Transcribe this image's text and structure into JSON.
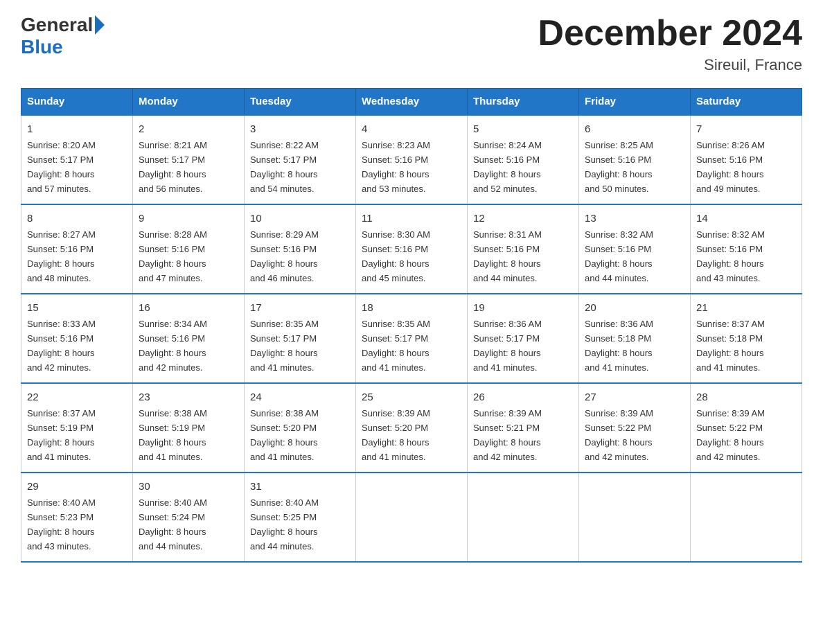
{
  "logo": {
    "general": "General",
    "blue": "Blue"
  },
  "title": "December 2024",
  "subtitle": "Sireuil, France",
  "weekdays": [
    "Sunday",
    "Monday",
    "Tuesday",
    "Wednesday",
    "Thursday",
    "Friday",
    "Saturday"
  ],
  "weeks": [
    [
      {
        "day": "1",
        "sunrise": "8:20 AM",
        "sunset": "5:17 PM",
        "daylight": "8 hours and 57 minutes."
      },
      {
        "day": "2",
        "sunrise": "8:21 AM",
        "sunset": "5:17 PM",
        "daylight": "8 hours and 56 minutes."
      },
      {
        "day": "3",
        "sunrise": "8:22 AM",
        "sunset": "5:17 PM",
        "daylight": "8 hours and 54 minutes."
      },
      {
        "day": "4",
        "sunrise": "8:23 AM",
        "sunset": "5:16 PM",
        "daylight": "8 hours and 53 minutes."
      },
      {
        "day": "5",
        "sunrise": "8:24 AM",
        "sunset": "5:16 PM",
        "daylight": "8 hours and 52 minutes."
      },
      {
        "day": "6",
        "sunrise": "8:25 AM",
        "sunset": "5:16 PM",
        "daylight": "8 hours and 50 minutes."
      },
      {
        "day": "7",
        "sunrise": "8:26 AM",
        "sunset": "5:16 PM",
        "daylight": "8 hours and 49 minutes."
      }
    ],
    [
      {
        "day": "8",
        "sunrise": "8:27 AM",
        "sunset": "5:16 PM",
        "daylight": "8 hours and 48 minutes."
      },
      {
        "day": "9",
        "sunrise": "8:28 AM",
        "sunset": "5:16 PM",
        "daylight": "8 hours and 47 minutes."
      },
      {
        "day": "10",
        "sunrise": "8:29 AM",
        "sunset": "5:16 PM",
        "daylight": "8 hours and 46 minutes."
      },
      {
        "day": "11",
        "sunrise": "8:30 AM",
        "sunset": "5:16 PM",
        "daylight": "8 hours and 45 minutes."
      },
      {
        "day": "12",
        "sunrise": "8:31 AM",
        "sunset": "5:16 PM",
        "daylight": "8 hours and 44 minutes."
      },
      {
        "day": "13",
        "sunrise": "8:32 AM",
        "sunset": "5:16 PM",
        "daylight": "8 hours and 44 minutes."
      },
      {
        "day": "14",
        "sunrise": "8:32 AM",
        "sunset": "5:16 PM",
        "daylight": "8 hours and 43 minutes."
      }
    ],
    [
      {
        "day": "15",
        "sunrise": "8:33 AM",
        "sunset": "5:16 PM",
        "daylight": "8 hours and 42 minutes."
      },
      {
        "day": "16",
        "sunrise": "8:34 AM",
        "sunset": "5:16 PM",
        "daylight": "8 hours and 42 minutes."
      },
      {
        "day": "17",
        "sunrise": "8:35 AM",
        "sunset": "5:17 PM",
        "daylight": "8 hours and 41 minutes."
      },
      {
        "day": "18",
        "sunrise": "8:35 AM",
        "sunset": "5:17 PM",
        "daylight": "8 hours and 41 minutes."
      },
      {
        "day": "19",
        "sunrise": "8:36 AM",
        "sunset": "5:17 PM",
        "daylight": "8 hours and 41 minutes."
      },
      {
        "day": "20",
        "sunrise": "8:36 AM",
        "sunset": "5:18 PM",
        "daylight": "8 hours and 41 minutes."
      },
      {
        "day": "21",
        "sunrise": "8:37 AM",
        "sunset": "5:18 PM",
        "daylight": "8 hours and 41 minutes."
      }
    ],
    [
      {
        "day": "22",
        "sunrise": "8:37 AM",
        "sunset": "5:19 PM",
        "daylight": "8 hours and 41 minutes."
      },
      {
        "day": "23",
        "sunrise": "8:38 AM",
        "sunset": "5:19 PM",
        "daylight": "8 hours and 41 minutes."
      },
      {
        "day": "24",
        "sunrise": "8:38 AM",
        "sunset": "5:20 PM",
        "daylight": "8 hours and 41 minutes."
      },
      {
        "day": "25",
        "sunrise": "8:39 AM",
        "sunset": "5:20 PM",
        "daylight": "8 hours and 41 minutes."
      },
      {
        "day": "26",
        "sunrise": "8:39 AM",
        "sunset": "5:21 PM",
        "daylight": "8 hours and 42 minutes."
      },
      {
        "day": "27",
        "sunrise": "8:39 AM",
        "sunset": "5:22 PM",
        "daylight": "8 hours and 42 minutes."
      },
      {
        "day": "28",
        "sunrise": "8:39 AM",
        "sunset": "5:22 PM",
        "daylight": "8 hours and 42 minutes."
      }
    ],
    [
      {
        "day": "29",
        "sunrise": "8:40 AM",
        "sunset": "5:23 PM",
        "daylight": "8 hours and 43 minutes."
      },
      {
        "day": "30",
        "sunrise": "8:40 AM",
        "sunset": "5:24 PM",
        "daylight": "8 hours and 44 minutes."
      },
      {
        "day": "31",
        "sunrise": "8:40 AM",
        "sunset": "5:25 PM",
        "daylight": "8 hours and 44 minutes."
      },
      null,
      null,
      null,
      null
    ]
  ],
  "labels": {
    "sunrise": "Sunrise:",
    "sunset": "Sunset:",
    "daylight": "Daylight:"
  }
}
